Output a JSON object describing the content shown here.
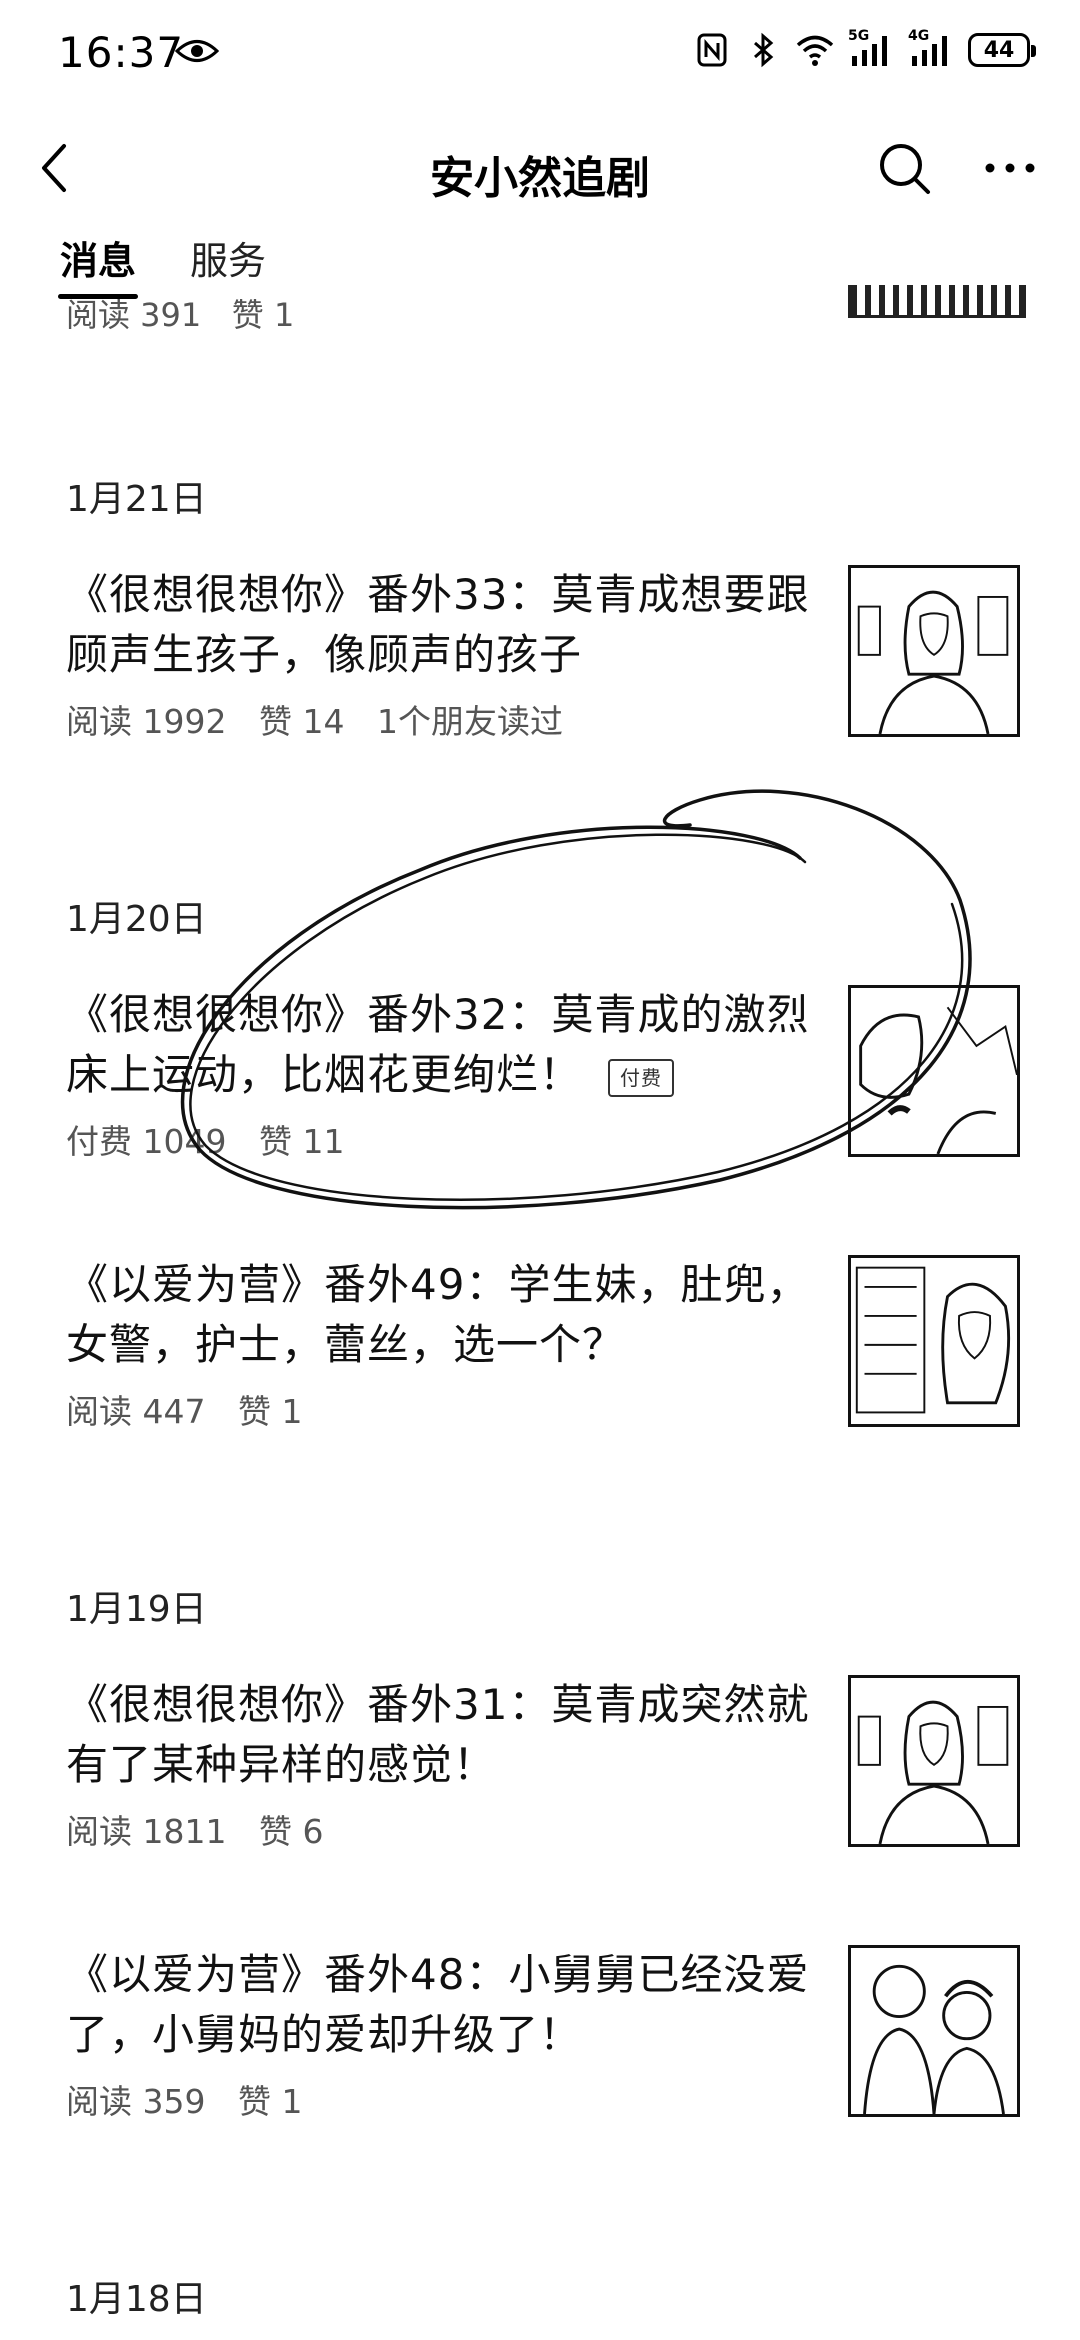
{
  "status_bar": {
    "time": "16:37",
    "net_5g": "5G",
    "net_4g": "4G",
    "battery": "44"
  },
  "header": {
    "title": "安小然追剧",
    "back_icon": "chevron-left-icon",
    "search_icon": "search-icon",
    "more_icon": "more-horizontal-icon"
  },
  "tabs": [
    {
      "label": "消息",
      "active": true
    },
    {
      "label": "服务",
      "active": false
    }
  ],
  "partial_top": {
    "read": "阅读 391",
    "likes": "赞 1"
  },
  "feed": [
    {
      "date": "1月21日",
      "items": [
        {
          "title": "《很想很想你》番外33：莫青成想要跟顾声生孩子，像顾声的孩子",
          "read": "阅读 1992",
          "likes": "赞 14",
          "friends": "1个朋友读过"
        }
      ]
    },
    {
      "date": "1月20日",
      "items": [
        {
          "title": "《很想很想你》番外32：莫青成的激烈床上运动，比烟花更绚烂！",
          "badge": "付费",
          "read": "付费 1049",
          "likes": "赞 11"
        },
        {
          "title": "《以爱为营》番外49：学生妹，肚兜，女警，护士，蕾丝，选一个？",
          "read": "阅读 447",
          "likes": "赞 1"
        }
      ]
    },
    {
      "date": "1月19日",
      "items": [
        {
          "title": "《很想很想你》番外31：莫青成突然就有了某种异样的感觉！",
          "read": "阅读 1811",
          "likes": "赞 6"
        },
        {
          "title": "《以爱为营》番外48：小舅舅已经没爱了，小舅妈的爱却升级了！",
          "read": "阅读 359",
          "likes": "赞 1"
        }
      ]
    },
    {
      "date": "1月18日",
      "items": []
    }
  ]
}
